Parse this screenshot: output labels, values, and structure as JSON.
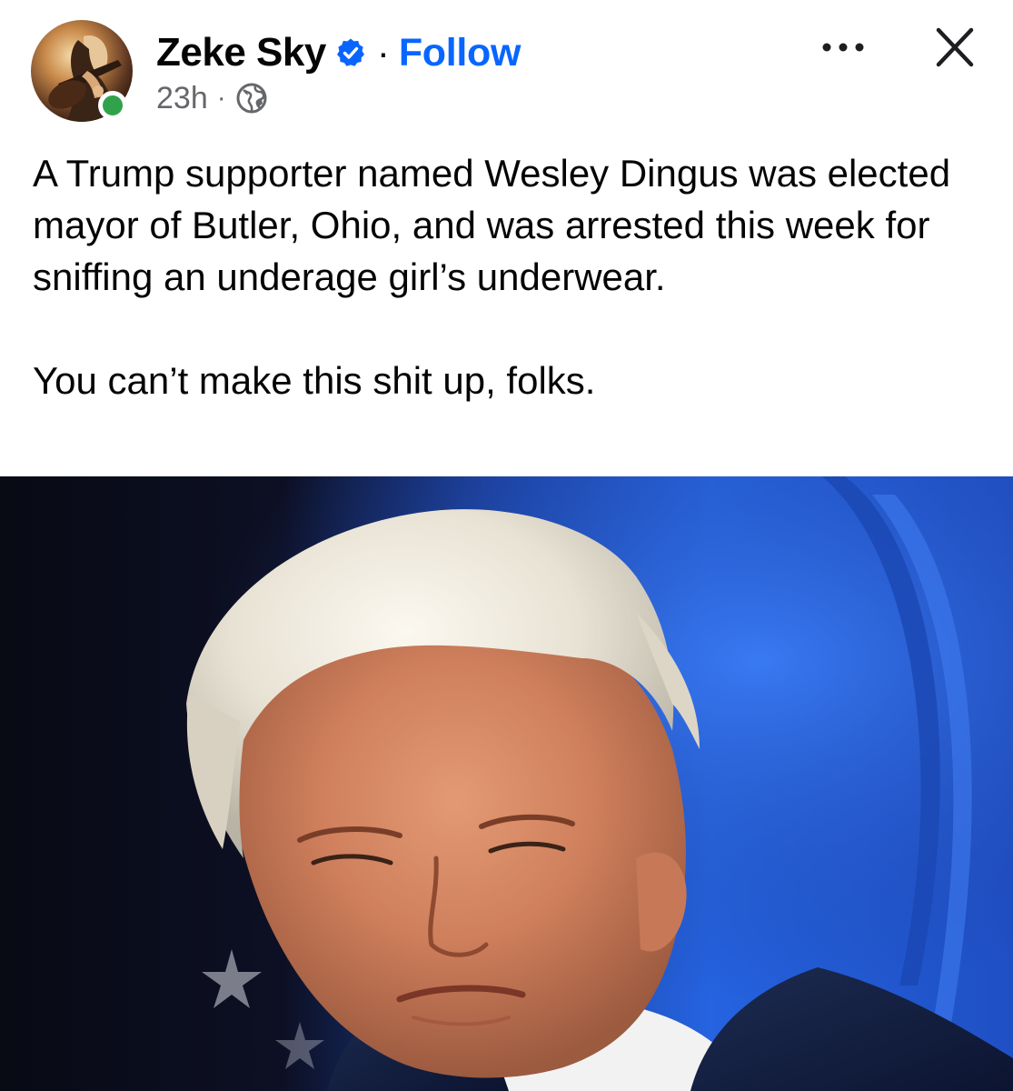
{
  "post": {
    "author": {
      "name": "Zeke Sky",
      "verified": true,
      "online": true
    },
    "follow_label": "Follow",
    "separator": "·",
    "timestamp": "23h",
    "audience_icon": "globe-icon",
    "actions": {
      "more_icon": "more-horizontal-icon",
      "close_icon": "close-icon"
    },
    "body": {
      "paragraph_1": "A Trump supporter named Wesley Dingus was elected mayor of Butler, Ohio, and was arrested this week for sniffing an underage girl’s underwear.",
      "paragraph_2": "You can’t make this shit up, folks."
    },
    "image": {
      "subject": "photo-of-man-with-white-hair-in-dark-suit"
    }
  },
  "colors": {
    "follow_blue": "#0866ff",
    "verified_blue": "#0866ff",
    "online_green": "#31a24c",
    "secondary_text": "#65676b",
    "primary_text": "#050505"
  }
}
